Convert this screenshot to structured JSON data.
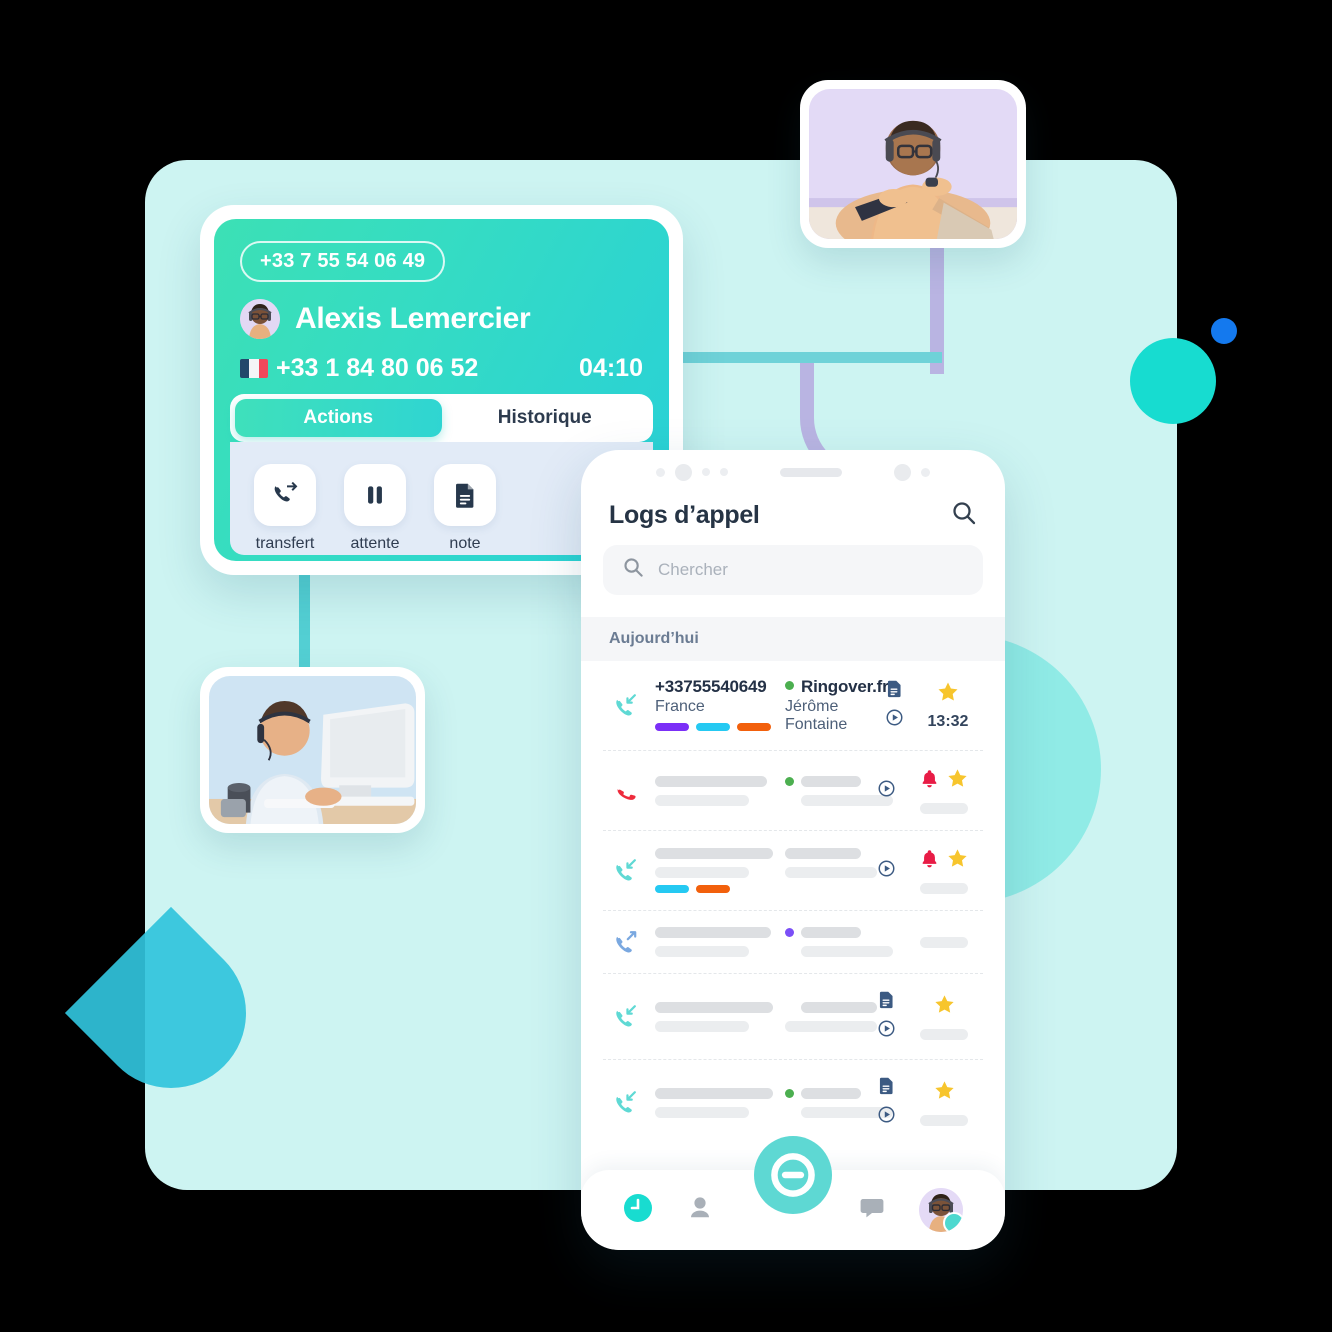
{
  "call_card": {
    "phone_badge": "+33 7 55 54 06 49",
    "caller_name": "Alexis Lemercier",
    "line_number": "+33 1 84 80 06 52",
    "timer": "04:10",
    "avatar_icon": "agent-avatar",
    "flag_icon": "france-flag-icon",
    "tabs": [
      {
        "label": "Actions",
        "active": true
      },
      {
        "label": "Historique",
        "active": false
      }
    ],
    "actions": [
      {
        "label": "transfert",
        "icon": "call-transfer-icon"
      },
      {
        "label": "attente",
        "icon": "pause-icon"
      },
      {
        "label": "note",
        "icon": "note-document-icon"
      }
    ]
  },
  "phone": {
    "header_title": "Logs d’appel",
    "header_search_icon": "search-icon",
    "search": {
      "placeholder": "Chercher",
      "icon": "search-icon",
      "value": ""
    },
    "day_header": "Aujourd’hui",
    "rows": [
      {
        "direction_icon": "call-incoming-icon",
        "number": "+33755540649",
        "country": "France",
        "account": "Ringover.fr",
        "agent": "Jérôme Fontaine",
        "status_dot": "#4caf50",
        "tags": [
          "#7b2ff7",
          "#25c9f2",
          "#f2600c"
        ],
        "note_icon": "note-document-icon",
        "play_icon": "play-recording-icon",
        "star_icon": "star-icon",
        "time": "13:32",
        "skeleton": false
      },
      {
        "direction_icon": "call-missed-icon",
        "status_dot": "#4caf50",
        "tags": [],
        "play_icon": "play-recording-icon",
        "bell_icon": "bell-alert-icon",
        "star_icon": "star-icon",
        "skeleton": true
      },
      {
        "direction_icon": "call-incoming-icon",
        "status_dot": null,
        "tags": [
          "#25c9f2",
          "#f2600c"
        ],
        "play_icon": "play-recording-icon",
        "bell_icon": "bell-alert-icon",
        "star_icon": "star-icon",
        "skeleton": true
      },
      {
        "direction_icon": "call-outgoing-icon",
        "status_dot": "#7b4ff7",
        "tags": [],
        "skeleton": true
      },
      {
        "direction_icon": "call-incoming-icon",
        "status_dot": null,
        "tags": [],
        "note_icon": "note-document-icon",
        "play_icon": "play-recording-icon",
        "star_icon": "star-icon",
        "skeleton": true
      },
      {
        "direction_icon": "call-incoming-icon",
        "status_dot": "#4caf50",
        "tags": [],
        "note_icon": "note-document-icon",
        "play_icon": "play-recording-icon",
        "star_icon": "star-icon",
        "skeleton": true
      }
    ],
    "navbar": [
      {
        "icon": "clock-history-icon",
        "active": true
      },
      {
        "icon": "contacts-person-icon",
        "active": false
      },
      {
        "icon": "ringover-dial-fab-icon",
        "active": false
      },
      {
        "icon": "chat-bubble-icon",
        "active": false
      },
      {
        "icon": "profile-avatar-icon",
        "active": false
      }
    ]
  },
  "decor": {
    "photo_top_right": "agent-headset-laptop-photo",
    "photo_bottom_left": "agent-headset-desktop-photo",
    "accent_teal": "#17dcd0",
    "accent_blue": "#1479ee",
    "panel_bg": "#cdf4f2",
    "connector_teal": "#6fd2d8",
    "connector_purple": "#b9b4e2"
  }
}
